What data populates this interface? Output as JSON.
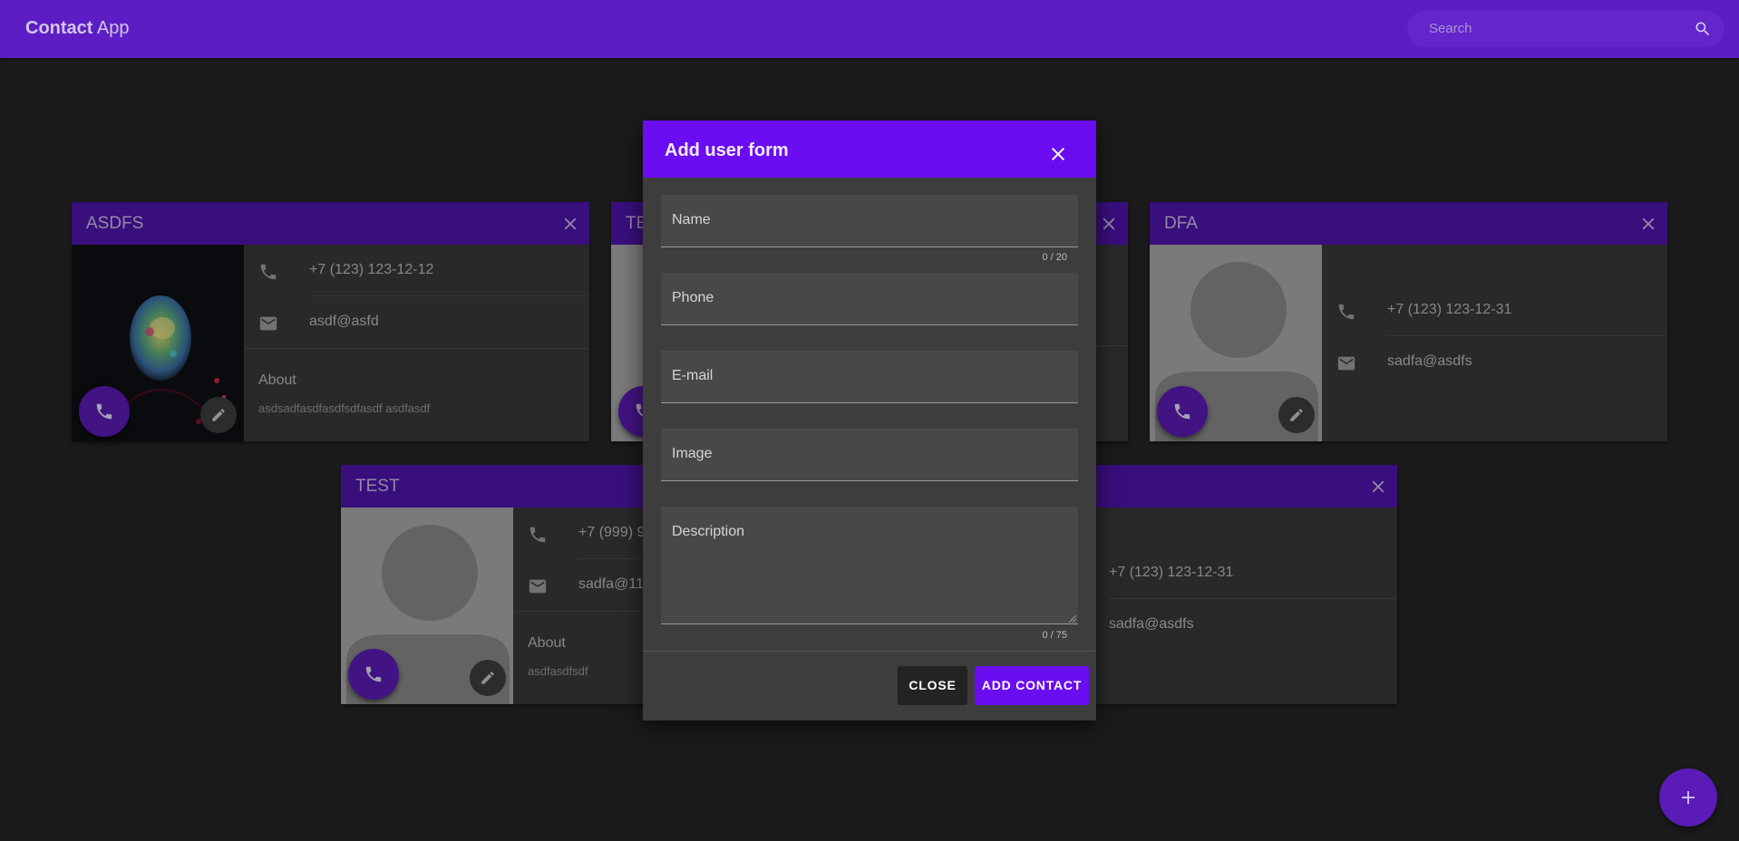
{
  "app": {
    "brand_bold": "Contact",
    "brand_rest": "App"
  },
  "search": {
    "placeholder": "Search",
    "icon": "search-icon"
  },
  "cards": {
    "asdfs": {
      "name": "ASDFS",
      "phone": "+7 (123) 123-12-12",
      "email": "asdf@asfd",
      "about_label": "About",
      "about": "asdsadfasdfasdfsdfasdf asdfasdf"
    },
    "te": {
      "name": "TE"
    },
    "dfa": {
      "name": "DFA",
      "phone": "+7 (123) 123-12-31",
      "email": "sadfa@asdfs"
    },
    "test": {
      "name": "TEST",
      "phone": "+7 (999) 9",
      "email": "sadfa@11",
      "about_label": "About",
      "about": "asdfasdfsdf"
    },
    "fifth": {
      "phone": "+7 (123) 123-12-31",
      "email": "sadfa@asdfs"
    }
  },
  "modal": {
    "title": "Add user form",
    "fields": {
      "name": "Name",
      "name_counter": "0 / 20",
      "phone": "Phone",
      "email": "E-mail",
      "image": "Image",
      "description": "Description",
      "description_counter": "0 / 75"
    },
    "close_label": "CLOSE",
    "add_label": "ADD CONTACT"
  },
  "colors": {
    "appbar": "#5c1ec4",
    "card_header": "#4f14ad",
    "modal_header": "#6a0df0",
    "background": "#262626"
  }
}
